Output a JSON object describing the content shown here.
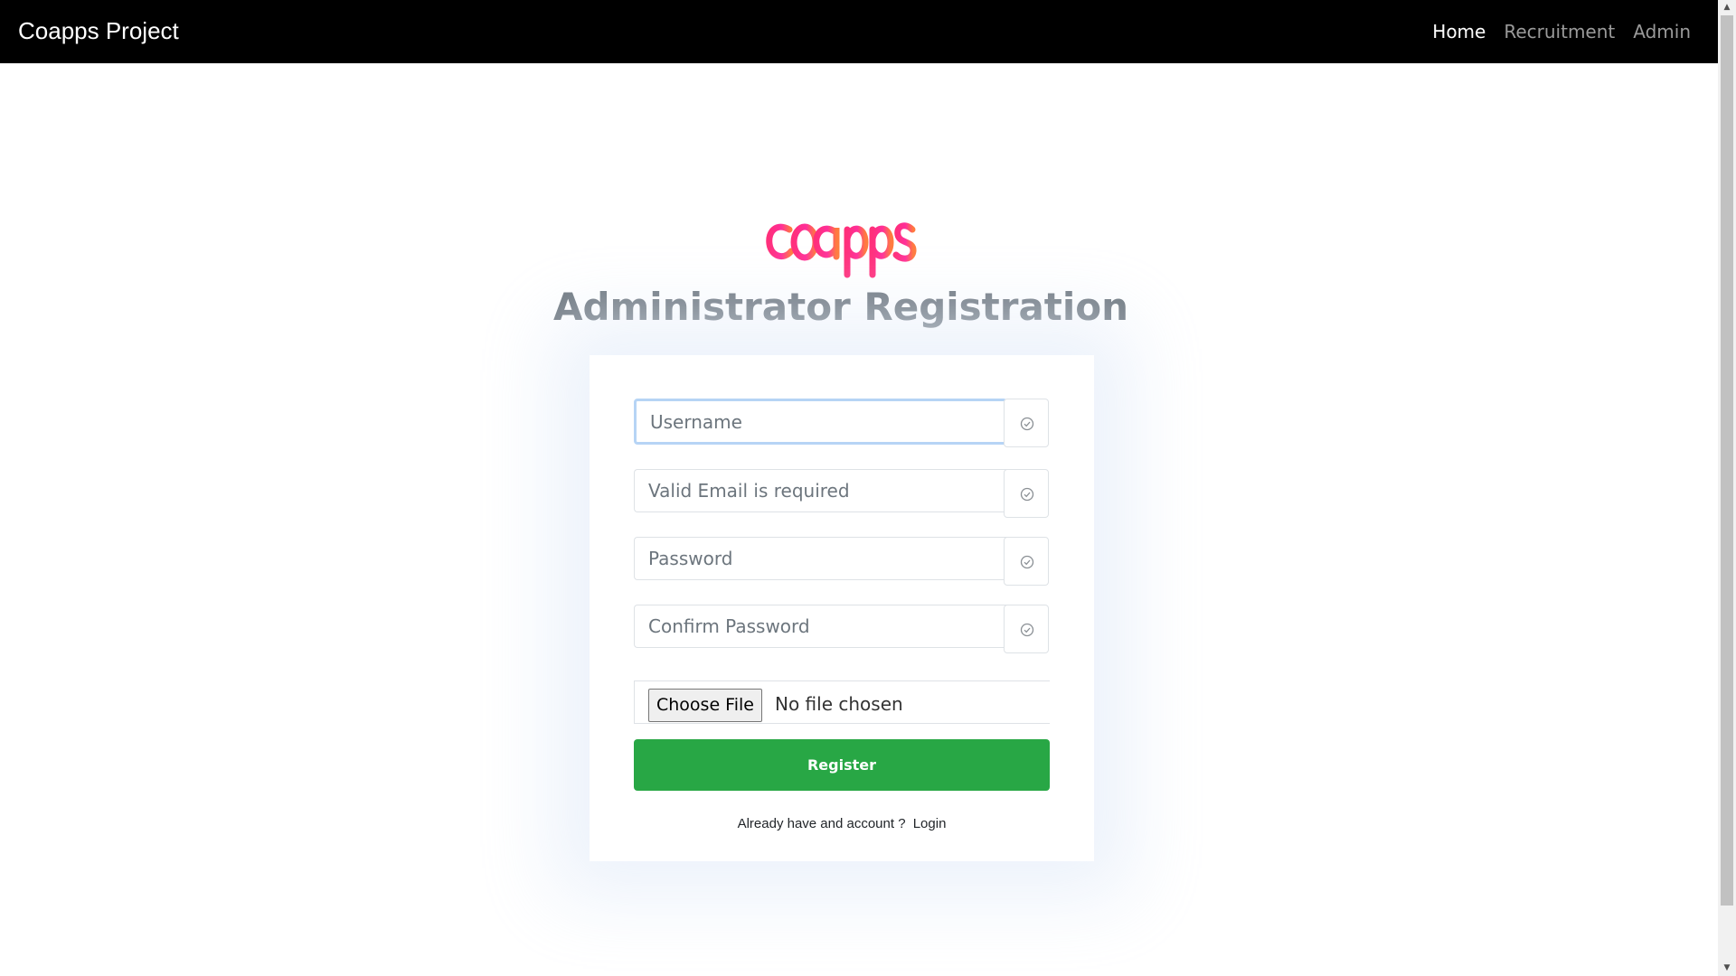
{
  "navbar": {
    "brand": "Coapps Project",
    "links": [
      {
        "label": "Home",
        "active": true
      },
      {
        "label": "Recruitment",
        "active": false
      },
      {
        "label": "Admin",
        "active": false
      }
    ]
  },
  "logo": {
    "text": "coapps",
    "gradient_colors": [
      "#ff2e7a",
      "#ff7a3d"
    ]
  },
  "page_title": "Administrator Registration",
  "form": {
    "username": {
      "placeholder": "Username",
      "value": ""
    },
    "email": {
      "placeholder": "Valid Email is required",
      "value": ""
    },
    "password": {
      "placeholder": "Password",
      "value": ""
    },
    "confirm_password": {
      "placeholder": "Confirm Password",
      "value": ""
    },
    "addon_icon": "check-circle-icon",
    "file": {
      "button_label": "Choose File",
      "status": "No file chosen"
    },
    "register_label": "Register",
    "register_color": "#28a745",
    "login_prompt": "Already have and account ?",
    "login_link": "Login"
  },
  "colors": {
    "navbar_bg": "#000000",
    "heading": "#6c757d",
    "focus_ring": "#b6d4f5"
  }
}
